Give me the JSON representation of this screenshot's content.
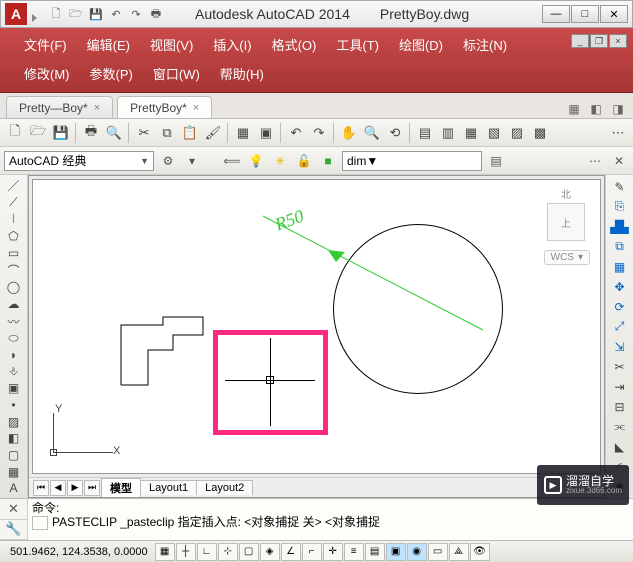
{
  "title": {
    "app": "Autodesk AutoCAD 2014",
    "file": "PrettyBoy.dwg"
  },
  "menus": {
    "row1": [
      "文件(F)",
      "编辑(E)",
      "视图(V)",
      "插入(I)",
      "格式(O)",
      "工具(T)",
      "绘图(D)",
      "标注(N)"
    ],
    "row2": [
      "修改(M)",
      "参数(P)",
      "窗口(W)",
      "帮助(H)"
    ]
  },
  "filetabs": {
    "items": [
      {
        "label": "Pretty—Boy*",
        "active": false
      },
      {
        "label": "PrettyBoy*",
        "active": true
      }
    ]
  },
  "workspace": {
    "combo": "AutoCAD 经典"
  },
  "layer": {
    "combo": "dim"
  },
  "viewcube": {
    "north": "北",
    "face": "上",
    "wcs": "WCS"
  },
  "dimension": {
    "text": "R50"
  },
  "ucs": {
    "x": "X",
    "y": "Y"
  },
  "layout": {
    "tabs": [
      "模型",
      "Layout1",
      "Layout2"
    ],
    "active": 0
  },
  "command": {
    "line1": "命令:",
    "line2": "PASTECLIP _pasteclip 指定插入点:   <对象捕捉 关>   <对象捕捉"
  },
  "status": {
    "coords": "501.9462, 124.3538, 0.0000"
  },
  "watermark": {
    "line1": "溜溜自学",
    "line2": "zixue.3d66.com"
  }
}
